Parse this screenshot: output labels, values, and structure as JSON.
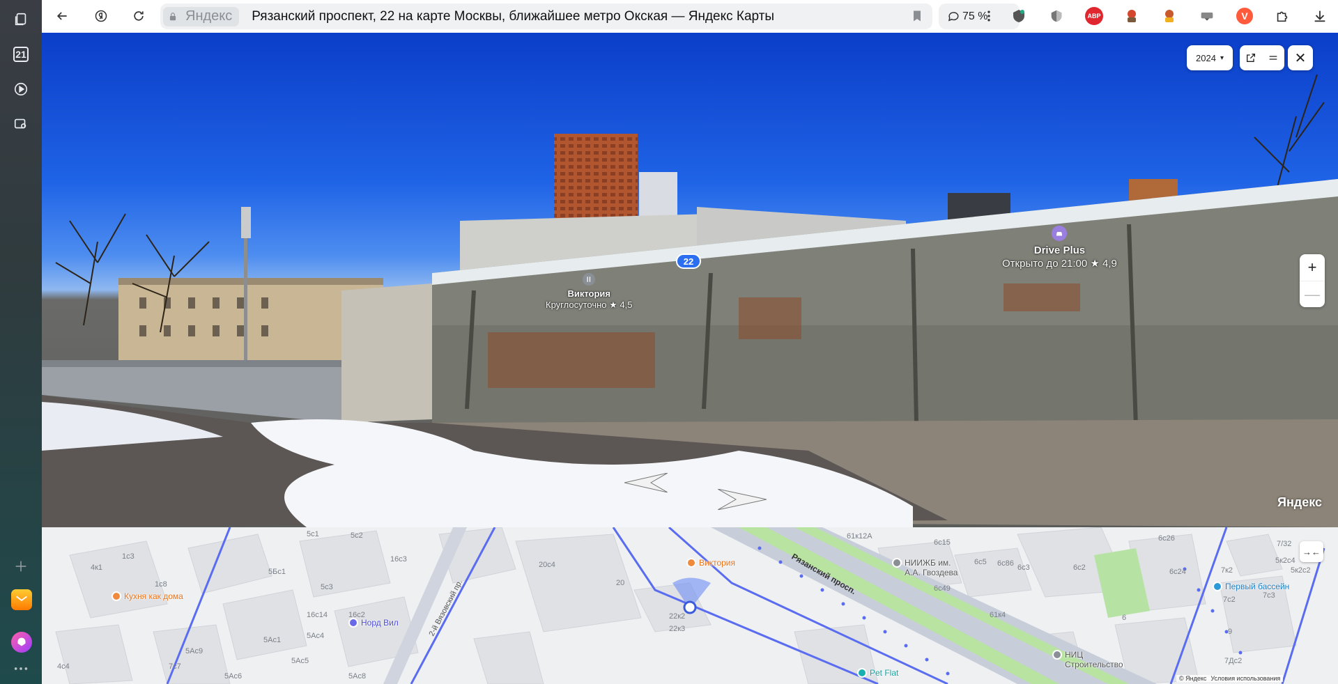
{
  "browser": {
    "domain": "Яндекс",
    "page_title": "Рязанский проспект, 22 на карте Москвы, ближайшее метро Окская — Яндекс Карты",
    "zoom_level": "75 %",
    "sidebar_calendar_day": "21"
  },
  "extensions": {
    "abp_label": "ABP",
    "vpn_label": "V"
  },
  "panorama": {
    "year": "2024",
    "year_caret": "▾",
    "house_number": "22",
    "zoom_in": "+",
    "zoom_out": "—",
    "close": "✕",
    "watermark": "Яндекс",
    "poi_victoria_name": "Виктория",
    "poi_victoria_status": "Круглосуточно",
    "poi_victoria_rating": "★ 4,5",
    "poi_drive_name": "Drive Plus",
    "poi_drive_status": "Открыто до 21:00",
    "poi_drive_rating": "★ 4,9"
  },
  "map": {
    "collapse_label": "→←",
    "pois": {
      "kitchen": "Кухня как дома",
      "nord": "Норд Вил",
      "victoria": "Виктория",
      "niizhb": "НИИЖБ им.",
      "niizhb2": "А.А. Гвоздева",
      "pool": "Первый бассейн",
      "nic": "НИЦ",
      "nic2": "Строительство",
      "petflat": "Pet Flat"
    },
    "street": "Рязанский просп.",
    "side_street": "2-й Вязовский пр.",
    "buildings": [
      "5с1",
      "5с2",
      "1с3",
      "4к1",
      "16с3",
      "5Бс1",
      "5с3",
      "1с8",
      "16с2",
      "16с14",
      "5Ас4",
      "5Ас1",
      "20с4",
      "20",
      "22к2",
      "22к3",
      "61к12А",
      "6с15",
      "6с5",
      "6с86",
      "6с3",
      "6с2",
      "6с26",
      "6с49",
      "6с24",
      "7/32",
      "5к2с4",
      "5к2с2",
      "7к2",
      "7с3",
      "7с2",
      "61к4",
      "6",
      "9",
      "7Дс2",
      "4с4",
      "5Ас9",
      "5Ас5",
      "7с7",
      "5Ас6",
      "5Ас8"
    ],
    "copyright": "© Яндекс",
    "terms": "Условия использования"
  }
}
